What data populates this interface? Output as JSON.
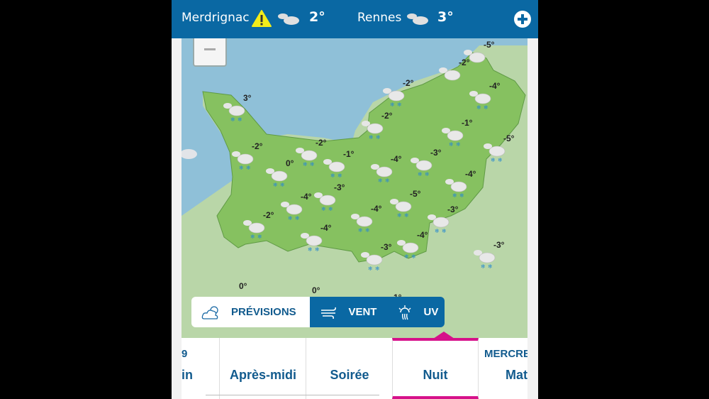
{
  "topbar": {
    "locations": [
      {
        "name": "Merdrignac",
        "alert": "warning-icon",
        "weather": "cloudy-icon",
        "temp": "2°"
      },
      {
        "name": "Rennes",
        "weather": "cloudy-icon",
        "temp": "3°"
      }
    ],
    "add_icon": "plus-circle-icon"
  },
  "map": {
    "zoom_out_icon": "minus-icon",
    "temperatures": [
      "-5°",
      "-2°",
      "-2°",
      "-4°",
      "3°",
      "-2°",
      "-1°",
      "-5°",
      "-2°",
      "-1°",
      "-2°",
      "0°",
      "-4°",
      "-3°",
      "-4°",
      "-3°",
      "-4°",
      "-5°",
      "-4°",
      "-3°",
      "-2°",
      "-4°",
      "-4°",
      "-3°",
      "-3°",
      "0°",
      "0°",
      "-1°"
    ],
    "colors": {
      "sea": "#8fc0d8",
      "region": "#86c160",
      "land": "#b9d6a8"
    }
  },
  "layers": [
    {
      "label": "PRÉVISIONS",
      "icon": "sun-cloud-icon",
      "active": true
    },
    {
      "label": "VENT",
      "icon": "wind-icon"
    },
    {
      "label": "UV",
      "icon": "uv-sun-icon"
    }
  ],
  "tabs": {
    "prev_day": "9",
    "prev_label": "in",
    "items": [
      "Après-midi",
      "Soirée",
      "Nuit"
    ],
    "active": "Nuit",
    "next_day": "MERCRE",
    "next_label": "Mat"
  },
  "colors": {
    "brand": "#0a68a3",
    "accent": "#d6118a"
  }
}
